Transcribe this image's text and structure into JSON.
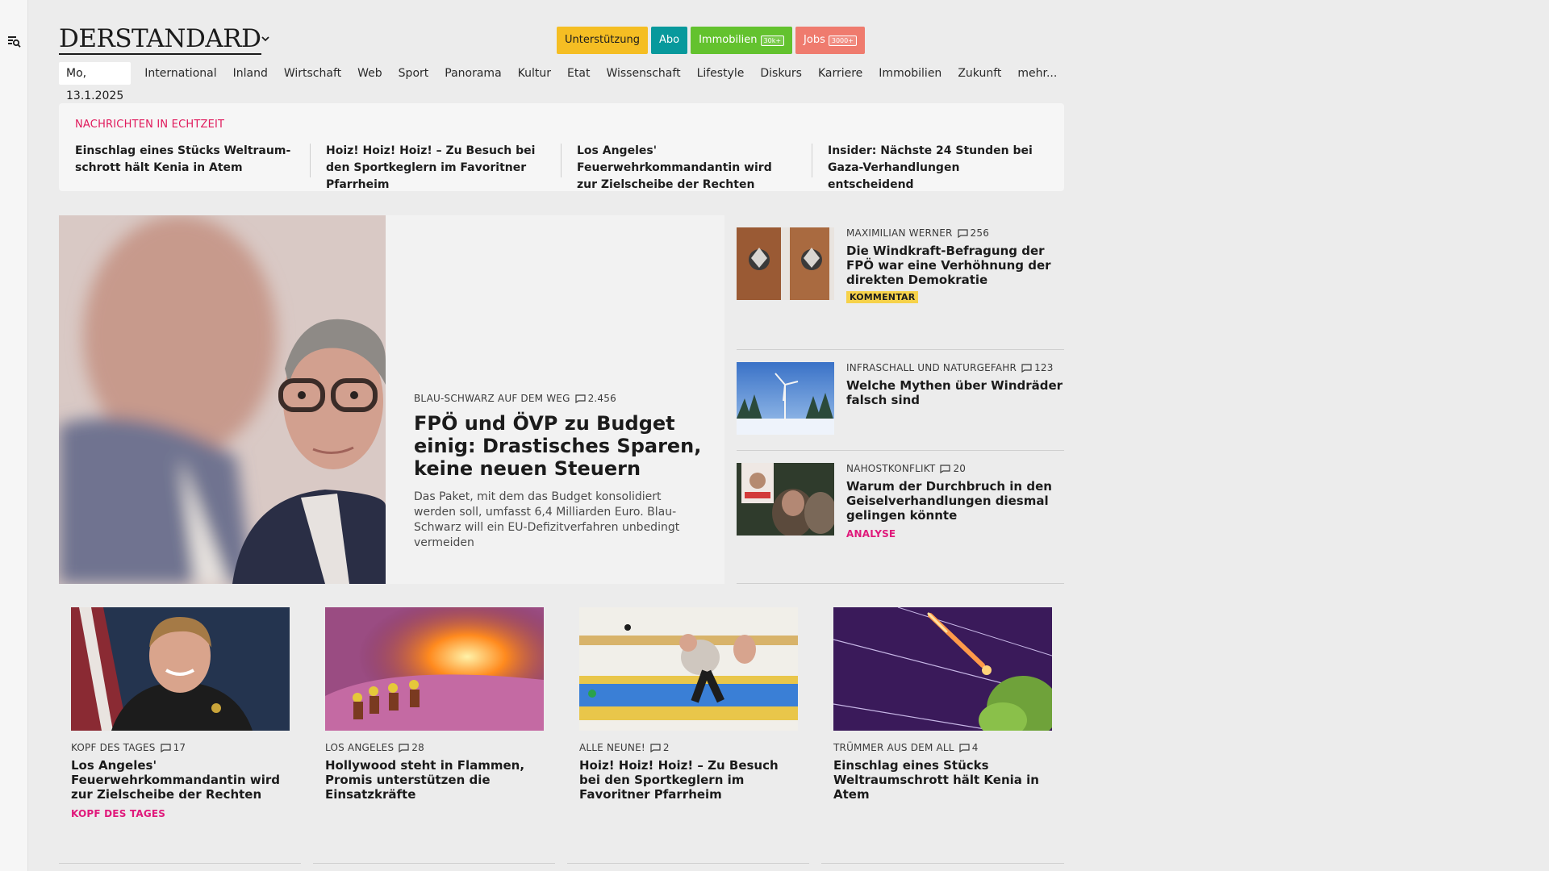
{
  "header": {
    "logo": "DERSTANDARD",
    "promo": [
      {
        "label": "Unterstützung",
        "badge": "",
        "color": "#f5be23",
        "text_color": "#1d1d1d"
      },
      {
        "label": "Abo",
        "badge": "",
        "color": "#08999c",
        "text_color": "#ffffff"
      },
      {
        "label": "Immobilien",
        "badge": "30k+",
        "color": "#63c22e",
        "text_color": "#ffffff"
      },
      {
        "label": "Jobs",
        "badge": "3000+",
        "color": "#ef7b6e",
        "text_color": "#ffffff"
      }
    ]
  },
  "nav": {
    "date": "Mo, 13.1.2025",
    "items": [
      "International",
      "Inland",
      "Wirtschaft",
      "Web",
      "Sport",
      "Panorama",
      "Kultur",
      "Etat",
      "Wissenschaft",
      "Lifestyle",
      "Diskurs",
      "Karriere",
      "Immobilien",
      "Zukunft",
      "mehr..."
    ]
  },
  "ticker": {
    "label": "NACHRICHTEN IN ECHTZEIT",
    "items": [
      "Einschlag eines Stücks Weltraum­schrott hält Kenia in Atem",
      "Hoiz! Hoiz! Hoiz! – Zu Besuch bei den Sportkeglern im Favoritner Pfarrheim",
      "Los Angeles' Feuerwehrkommandan­tin wird zur Zielscheibe der Rechten",
      "Insider: Nächste 24 Stunden bei Gaza-Verhandlungen entscheidend"
    ]
  },
  "hero": {
    "kicker": "BLAU-SCHWARZ AUF DEM WEG",
    "comments": "2.456",
    "title": "FPÖ und ÖVP zu Budget einig: Drastisches Sparen, keine neuen Steuern",
    "lead": "Das Paket, mit dem das Budget konsolidiert werden soll, umfasst 6,4 Milliarden Euro. Blau-Schwarz will ein EU-Defizitverfahren unbedingt vermeiden"
  },
  "side": [
    {
      "kicker": "MAXIMILIAN WERNER",
      "comments": "256",
      "title": "Die Windkraft-Befragung der FPÖ war eine Verhöhnung der direkten Demokratie",
      "tag": "KOMMENTAR"
    },
    {
      "kicker": "INFRASCHALL UND NATURGEFAHR",
      "comments": "123",
      "title": "Welche Mythen über Windräder falsch sind",
      "tag": ""
    },
    {
      "kicker": "NAHOSTKONFLIKT",
      "comments": "20",
      "title": "Warum der Durchbruch in den Geiselverhandlungen diesmal gelingen könnte",
      "tag": "ANALYSE"
    }
  ],
  "cards": [
    {
      "kicker": "KOPF DES TAGES",
      "comments": "17",
      "title": "Los Angeles' Feuerwehrkomman­dantin wird zur Zielscheibe der Rechten",
      "tag": "KOPF DES TAGES"
    },
    {
      "kicker": "LOS ANGELES",
      "comments": "28",
      "title": "Hollywood steht in Flammen, Promis unterstützen die Einsatzkräfte",
      "tag": ""
    },
    {
      "kicker": "ALLE NEUNE!",
      "comments": "2",
      "title": "Hoiz! Hoiz! Hoiz! – Zu Besuch bei den Sportkeglern im Favoritner Pfarrheim",
      "tag": ""
    },
    {
      "kicker": "TRÜMMER AUS DEM ALL",
      "comments": "4",
      "title": "Einschlag eines Stücks Weltraum­schrott hält Kenia in Atem",
      "tag": ""
    }
  ],
  "icons": {
    "menu": "search-menu-icon",
    "chevron": "chevron-down-icon",
    "comment": "comment-icon"
  },
  "colors": {
    "accent_live": "#e0195b",
    "tag_pink": "#e0197b",
    "tag_yellow": "#f6d24a"
  }
}
